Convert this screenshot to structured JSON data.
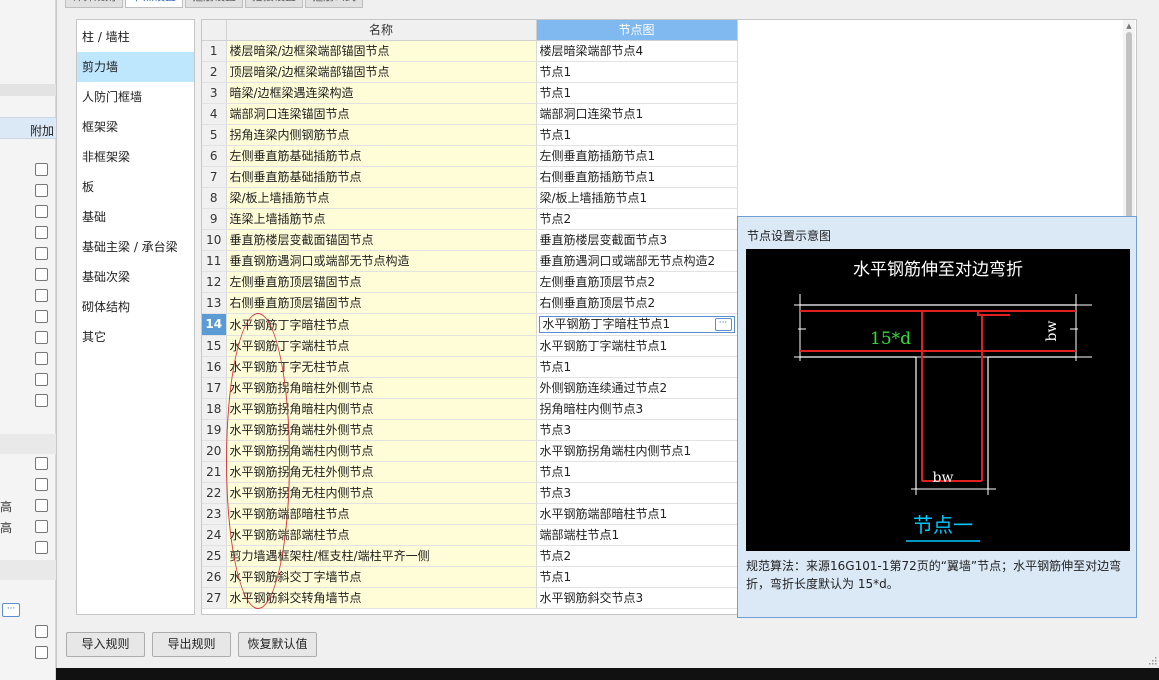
{
  "tabs": [
    "计算规则",
    "节点设置",
    "箍筋设置",
    "搭接设置",
    "箍筋公式"
  ],
  "active_tab": 1,
  "categories": [
    "柱 / 墙柱",
    "剪力墙",
    "人防门框墙",
    "框架梁",
    "非框架梁",
    "板",
    "基础",
    "基础主梁 / 承台梁",
    "基础次梁",
    "砌体结构",
    "其它"
  ],
  "selected_category": 1,
  "grid": {
    "headers": {
      "name": "名称",
      "node": "节点图"
    },
    "rows": [
      {
        "idx": "1",
        "name": "楼层暗梁/边框梁端部锚固节点",
        "node": "楼层暗梁端部节点4"
      },
      {
        "idx": "2",
        "name": "顶层暗梁/边框梁端部锚固节点",
        "node": "节点1"
      },
      {
        "idx": "3",
        "name": "暗梁/边框梁遇连梁构造",
        "node": "节点1"
      },
      {
        "idx": "4",
        "name": "端部洞口连梁锚固节点",
        "node": "端部洞口连梁节点1"
      },
      {
        "idx": "5",
        "name": "拐角连梁内侧钢筋节点",
        "node": "节点1"
      },
      {
        "idx": "6",
        "name": "左侧垂直筋基础插筋节点",
        "node": "左侧垂直筋插筋节点1"
      },
      {
        "idx": "7",
        "name": "右侧垂直筋基础插筋节点",
        "node": "右侧垂直筋插筋节点1"
      },
      {
        "idx": "8",
        "name": "梁/板上墙插筋节点",
        "node": "梁/板上墙插筋节点1"
      },
      {
        "idx": "9",
        "name": "连梁上墙插筋节点",
        "node": "节点2"
      },
      {
        "idx": "10",
        "name": "垂直筋楼层变截面锚固节点",
        "node": "垂直筋楼层变截面节点3"
      },
      {
        "idx": "11",
        "name": "垂直钢筋遇洞口或端部无节点构造",
        "node": "垂直筋遇洞口或端部无节点构造2"
      },
      {
        "idx": "12",
        "name": "左侧垂直筋顶层锚固节点",
        "node": "左侧垂直筋顶层节点2"
      },
      {
        "idx": "13",
        "name": "右侧垂直筋顶层锚固节点",
        "node": "右侧垂直筋顶层节点2"
      },
      {
        "idx": "14",
        "name": "水平钢筋丁字暗柱节点",
        "node": "水平钢筋丁字暗柱节点1"
      },
      {
        "idx": "15",
        "name": "水平钢筋丁字端柱节点",
        "node": "水平钢筋丁字端柱节点1"
      },
      {
        "idx": "16",
        "name": "水平钢筋丁字无柱节点",
        "node": "节点1"
      },
      {
        "idx": "17",
        "name": "水平钢筋拐角暗柱外侧节点",
        "node": "外侧钢筋连续通过节点2"
      },
      {
        "idx": "18",
        "name": "水平钢筋拐角暗柱内侧节点",
        "node": "拐角暗柱内侧节点3"
      },
      {
        "idx": "19",
        "name": "水平钢筋拐角端柱外侧节点",
        "node": "节点3"
      },
      {
        "idx": "20",
        "name": "水平钢筋拐角端柱内侧节点",
        "node": "水平钢筋拐角端柱内侧节点1"
      },
      {
        "idx": "21",
        "name": "水平钢筋拐角无柱外侧节点",
        "node": "节点1"
      },
      {
        "idx": "22",
        "name": "水平钢筋拐角无柱内侧节点",
        "node": "节点3"
      },
      {
        "idx": "23",
        "name": "水平钢筋端部暗柱节点",
        "node": "水平钢筋端部暗柱节点1"
      },
      {
        "idx": "24",
        "name": "水平钢筋端部端柱节点",
        "node": "端部端柱节点1"
      },
      {
        "idx": "25",
        "name": "剪力墙遇框架柱/框支柱/端柱平齐一侧",
        "node": "节点2"
      },
      {
        "idx": "26",
        "name": "水平钢筋斜交丁字墙节点",
        "node": "节点1"
      },
      {
        "idx": "27",
        "name": "水平钢筋斜交转角墙节点",
        "node": "水平钢筋斜交节点3"
      }
    ],
    "current_row": 13,
    "edit_button": "···"
  },
  "preview": {
    "title": "节点设置示意图",
    "diagram_title": "水平钢筋伸至对边弯折",
    "label_anchor": "15*d",
    "label_bw": "bw",
    "label_node": "节点一",
    "description": "规范算法：来源16G101-1第72页的“翼墙”节点；水平钢筋伸至对边弯折，弯折长度默认为 15*d。"
  },
  "buttons": {
    "import": "导入规则",
    "export": "导出规则",
    "restore": "恢复默认值"
  },
  "background": {
    "column_header": "附加",
    "frag_a": "高",
    "frag_b": "高",
    "dots": "···"
  },
  "colors": {
    "name_cell": "#fffcd8",
    "node_header": "#7fb9ef",
    "selected_row": "#5b9bd5",
    "category_selected": "#bee6fd",
    "rebar": "#e02020",
    "dim_white": "#ffffff",
    "label_green": "#33dd33",
    "node_label": "#00c8ff"
  }
}
